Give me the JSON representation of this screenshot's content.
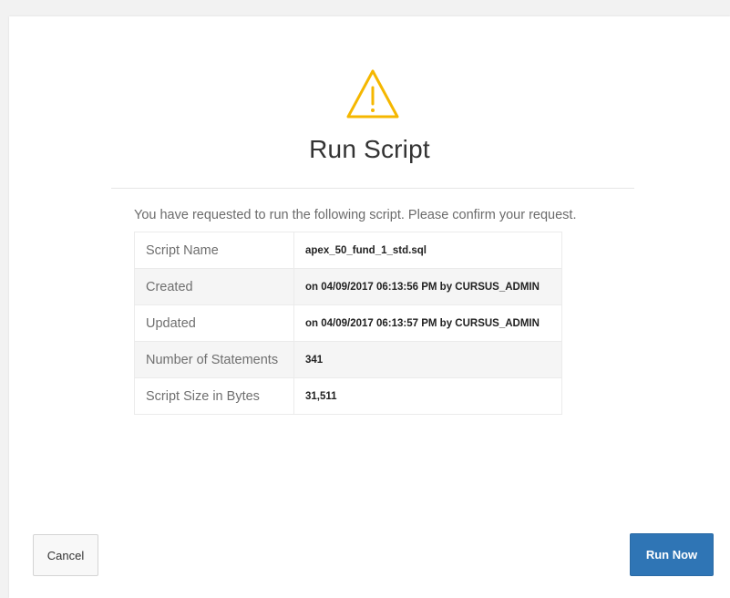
{
  "dialog": {
    "icon": "warning-triangle-icon",
    "icon_color": "#f5b700",
    "title": "Run Script",
    "message": "You have requested to run the following script. Please confirm your request."
  },
  "details": [
    {
      "label": "Script Name",
      "value": "apex_50_fund_1_std.sql"
    },
    {
      "label": "Created",
      "value": "on 04/09/2017 06:13:56 PM by CURSUS_ADMIN"
    },
    {
      "label": "Updated",
      "value": "on 04/09/2017 06:13:57 PM by CURSUS_ADMIN"
    },
    {
      "label": "Number of Statements",
      "value": "341"
    },
    {
      "label": "Script Size in Bytes",
      "value": "31,511"
    }
  ],
  "buttons": {
    "cancel_label": "Cancel",
    "run_label": "Run Now",
    "run_color": "#2f75b5"
  }
}
